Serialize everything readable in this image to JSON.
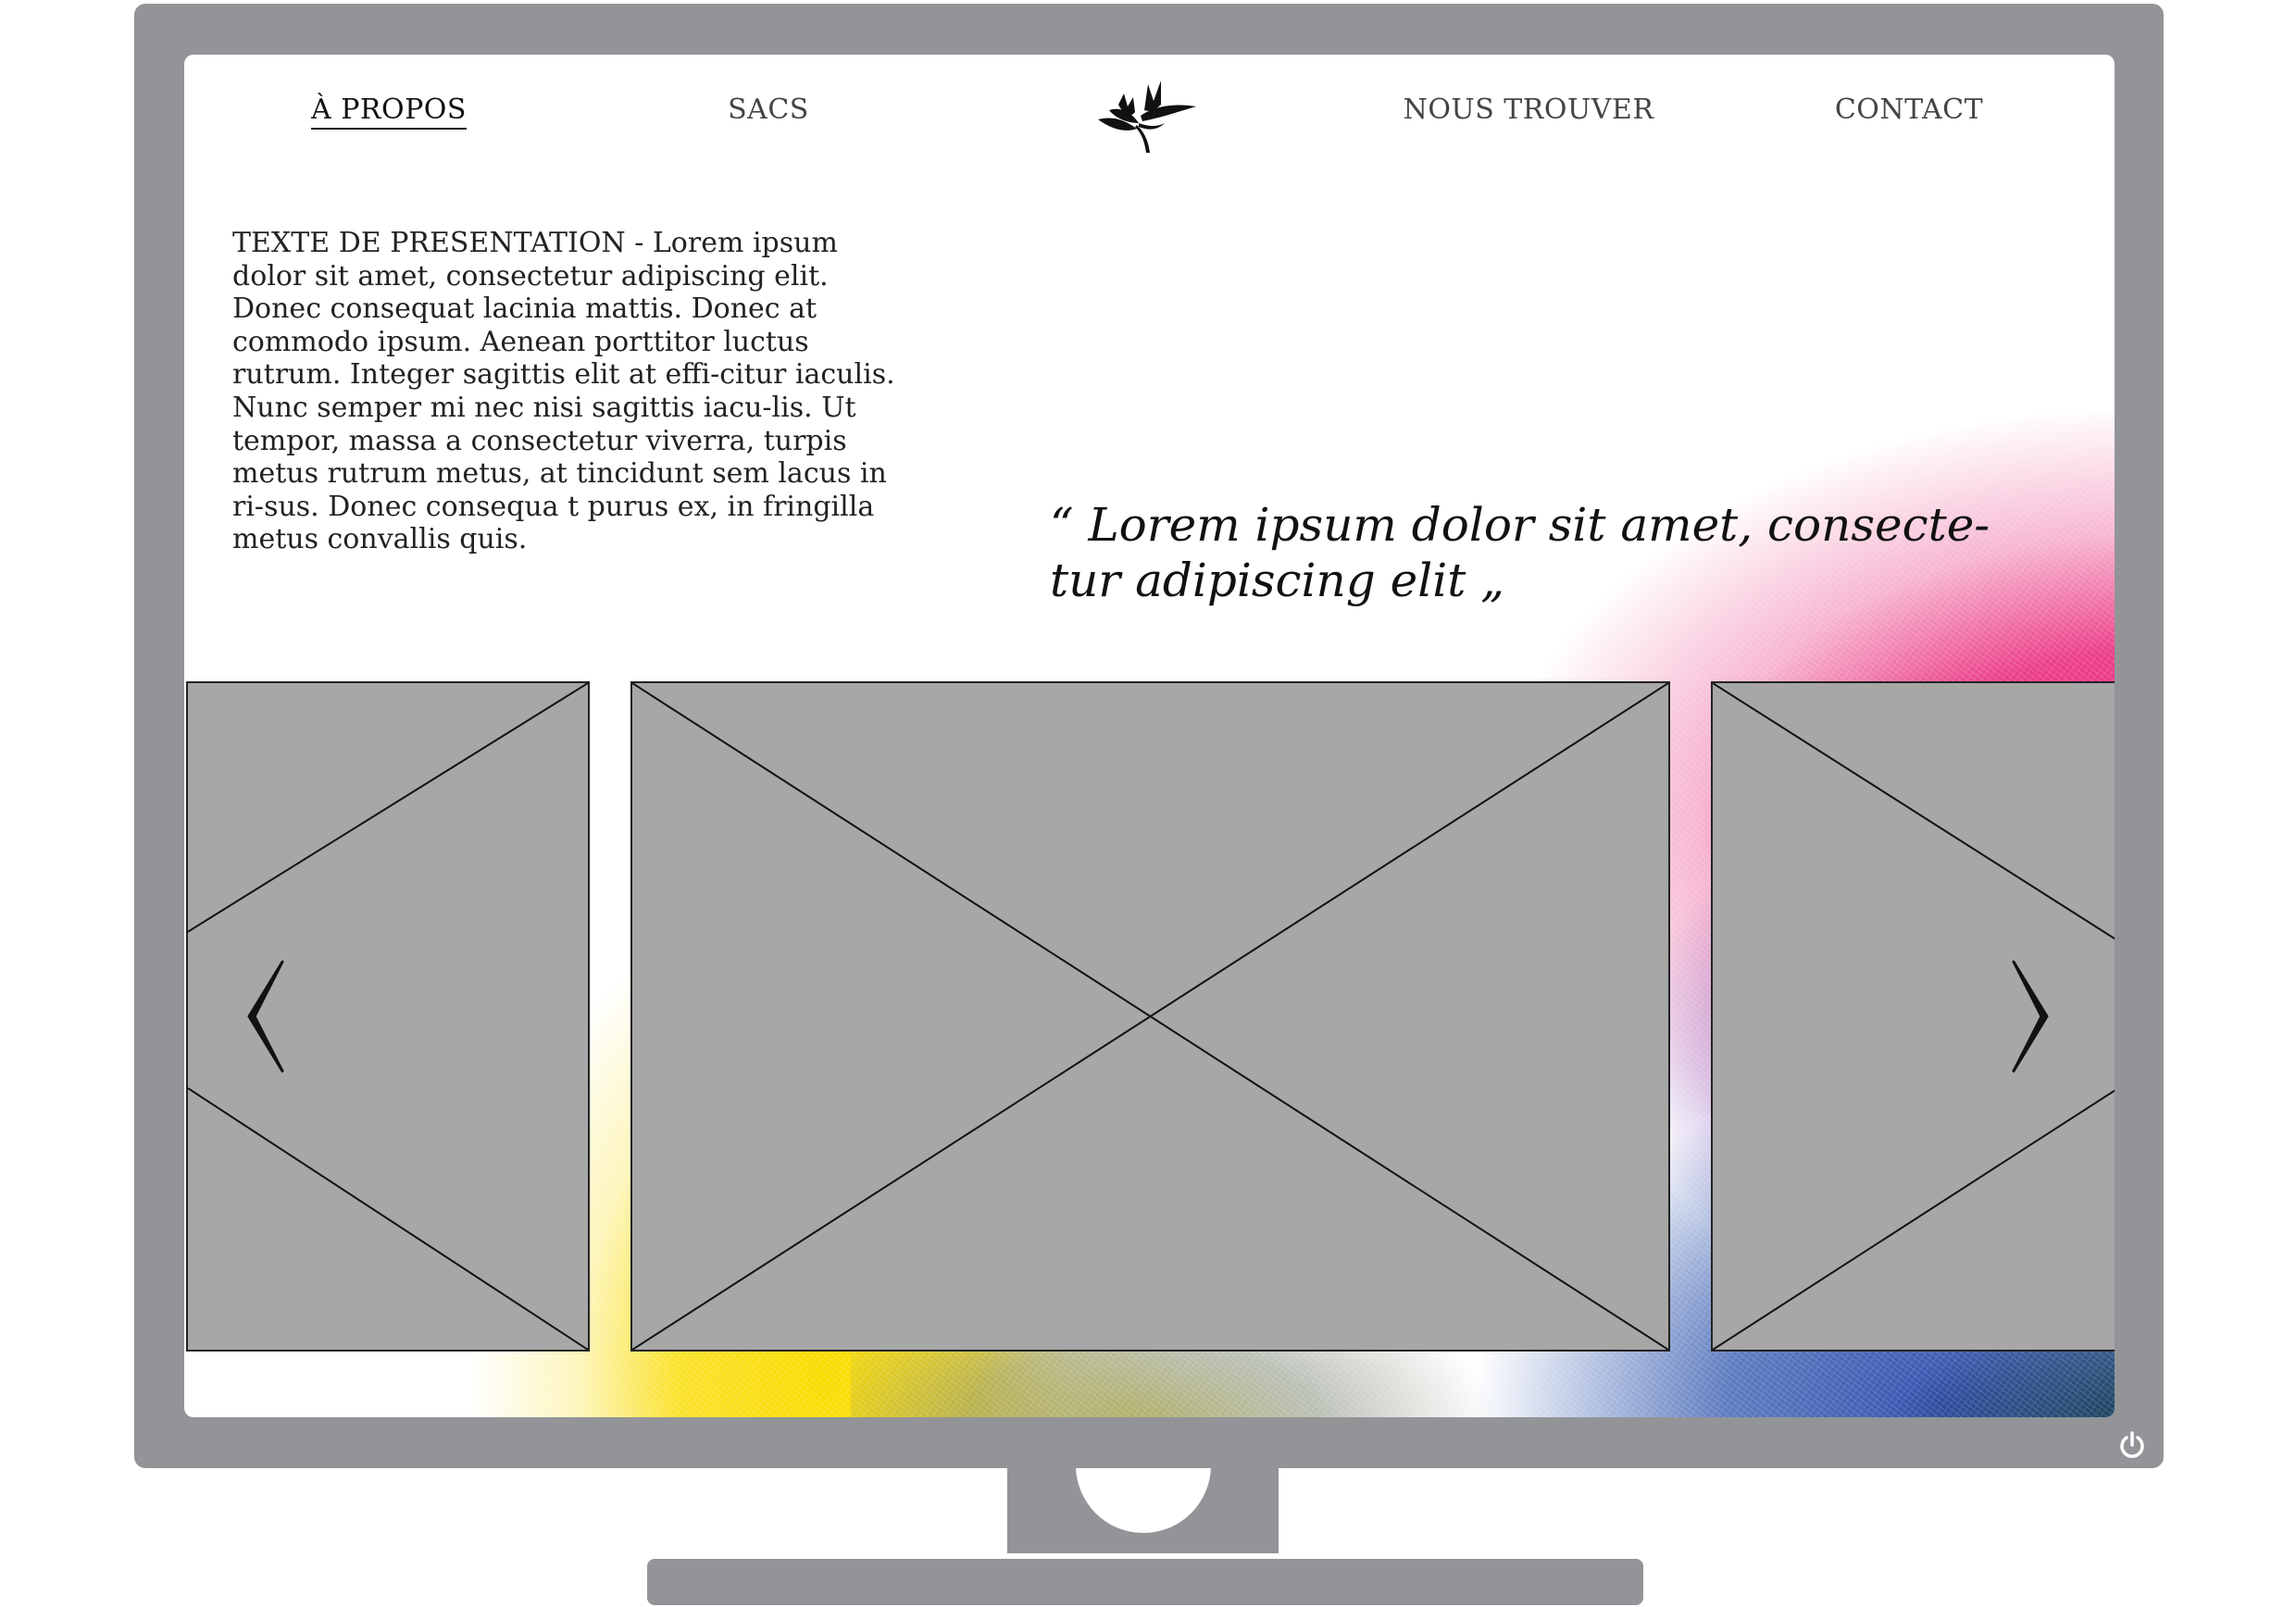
{
  "nav": {
    "items": [
      {
        "label": "À PROPOS",
        "active": true
      },
      {
        "label": "SACS",
        "active": false
      },
      {
        "label": "NOUS TROUVER",
        "active": false
      },
      {
        "label": "CONTACT",
        "active": false
      }
    ],
    "logo": "bird-of-paradise-flower-logo"
  },
  "main": {
    "presentation": "TEXTE DE PRESENTATION - Lorem ipsum dolor sit amet, consectetur adipiscing elit. Donec consequat lacinia mattis. Donec at commodo ipsum. Aenean porttitor luctus rutrum. Integer sagittis elit at effi-citur iaculis. Nunc semper mi nec nisi sagittis iacu-lis. Ut tempor, massa a consectetur viverra, turpis metus rutrum metus, at tincidunt sem lacus in ri-sus. Donec consequa t purus ex, in fringilla metus convallis quis.",
    "quote": "“ Lorem ipsum dolor sit amet, consecte-tur adipiscing elit „"
  },
  "carousel": {
    "prev_icon": "chevron-left-icon",
    "next_icon": "chevron-right-icon",
    "slides": [
      "image-placeholder",
      "image-placeholder",
      "image-placeholder"
    ]
  },
  "hardware": {
    "power_icon": "power-icon"
  },
  "colors": {
    "bezel": "#939498",
    "placeholder": "#a7a7a7",
    "gradient": [
      "#e81e74",
      "#8c3caa",
      "#2846aa",
      "#fadc00",
      "#0c2828"
    ]
  }
}
